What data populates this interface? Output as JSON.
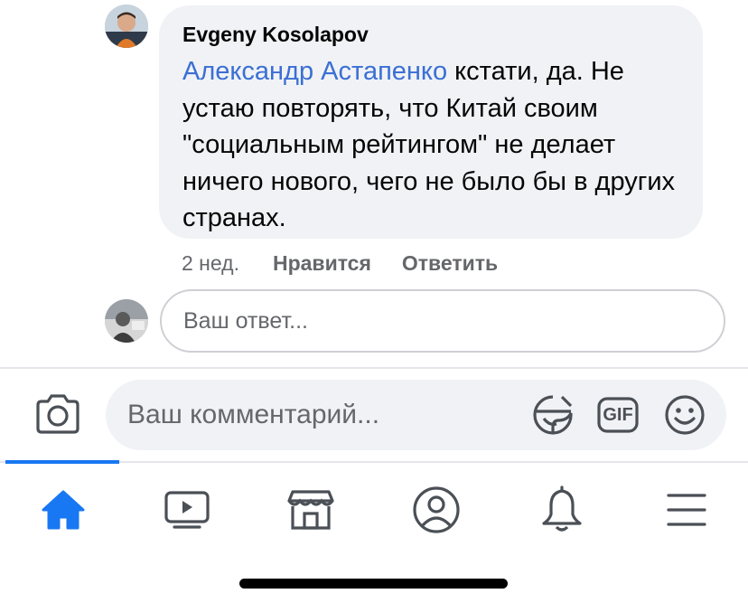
{
  "comment": {
    "author": "Evgeny Kosolapov",
    "mention": "Александр Астапенко",
    "text": " кстати, да. Не устаю повторять, что Китай своим \"социальным рейтингом\" не делает ничего нового, чего не было бы в других странах.",
    "time": "2 нед.",
    "like_label": "Нравится",
    "reply_label": "Ответить"
  },
  "reply": {
    "placeholder": "Ваш ответ..."
  },
  "composer": {
    "placeholder": "Ваш комментарий...",
    "gif_label": "GIF",
    "icons": [
      "camera-icon",
      "sticker-icon",
      "gif-icon",
      "emoji-icon"
    ]
  },
  "tabbar": {
    "items": [
      "home",
      "watch",
      "marketplace",
      "profile",
      "notifications",
      "menu"
    ],
    "active": "home"
  },
  "colors": {
    "accent": "#1877f2",
    "mention": "#3b6fd4",
    "bubble": "#f0f2f5",
    "muted_text": "#65676b",
    "icon": "#4b4f56"
  }
}
